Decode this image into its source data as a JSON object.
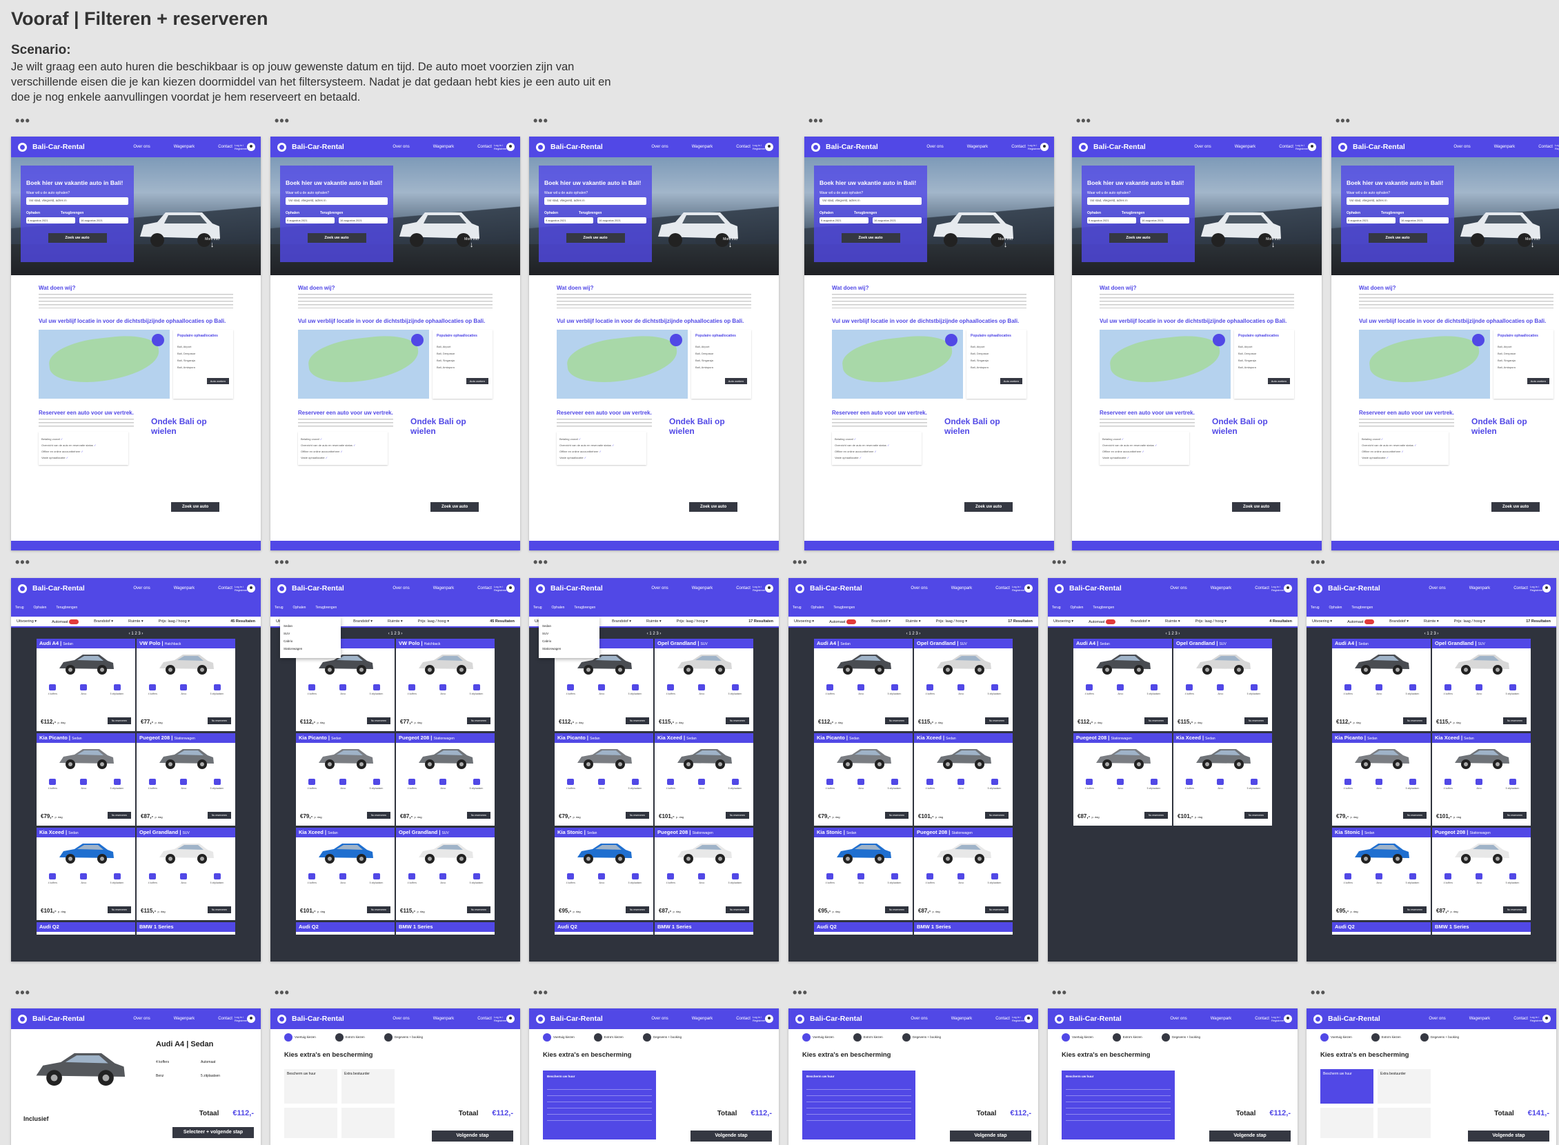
{
  "title": "Vooraf | Filteren + reserveren",
  "scenario_heading": "Scenario:",
  "scenario_text": "Je wilt graag een auto huren die beschikbaar is op jouw gewenste datum en tijd. De auto moet voorzien zijn van verschillende eisen die je kan kiezen doormiddel van het filtersysteem. Nadat je dat gedaan hebt kies je een auto uit en doe je nog enkele aanvullingen voordat je hem reserveert en betaald.",
  "brand": "Bali-Car-Rental",
  "nav": [
    "Over ons",
    "Wagenpark",
    "Contact"
  ],
  "login": "Log in / Registreer",
  "hero": {
    "title": "Boek hier uw vakantie auto in Bali!",
    "where": "Waar wil u de auto ophalen?",
    "where_placeholder": "Vul stad, vliegveld, adres in",
    "ophalen": "Ophalen",
    "terugbrengen": "Terugbrengen",
    "date1": "9 augustus 2021",
    "date2": "16 augustus 2021",
    "button": "Zoek uw auto",
    "more": "More info"
  },
  "home": {
    "wat": "Wat doen wij?",
    "vul": "Vul uw verblijf locatie in voor de dichtstbijzijnde ophaallocaties op Bali.",
    "pop": "Populaire ophaallocaties",
    "locs": [
      "Bali, Airport",
      "Bali, Denpasar",
      "Bali, Singaraja",
      "Bali, Amlapura"
    ],
    "auto_zoeken": "Auto zoeken",
    "res": "Reserveer een auto voor uw vertrek.",
    "ondek": "Ondek Bali op wielen",
    "checks": [
      "Betaling vooraf",
      "Overzicht van de auto en reservatie status",
      "Offline en online accountbeheer",
      "Vaste ophaallocatie"
    ],
    "zoek": "Zoek uw auto"
  },
  "results": {
    "back": "Terug",
    "ophalen": "Ophalen",
    "terug": "Terugbrengen",
    "filters": [
      "Uitvoering",
      "Automaat",
      "Brandstof",
      "Ruimte",
      "Prijs: laag / hoog"
    ],
    "counts": [
      "45 Resultaten",
      "45 Resultaten",
      "17 Resultaten",
      "17 Resultaten",
      "4 Resultaten",
      "17 Resultaten"
    ],
    "pages": "‹ 1 2 3 ›",
    "dropdown": [
      "Sedan",
      "SUV",
      "Cabrio",
      "Stationwagen"
    ],
    "reserveren": "Nu reserveren",
    "per": "p. dag"
  },
  "screens": [
    [
      {
        "n": "Audi A4",
        "t": "Sedan",
        "p": "€112,-"
      },
      {
        "n": "VW Polo",
        "t": "Hatchback",
        "p": "€77,-"
      },
      {
        "n": "Kia Picanto",
        "t": "Sedan",
        "p": "€79,-"
      },
      {
        "n": "Puegeot 208",
        "t": "Stationwagen",
        "p": "€87,-"
      },
      {
        "n": "Kia Xceed",
        "t": "Sedan",
        "p": "€101,-"
      },
      {
        "n": "Opel Grandland",
        "t": "SUV",
        "p": "€115,-"
      }
    ],
    [
      {
        "n": "Audi A4",
        "t": "Sedan",
        "p": "€112,-"
      },
      {
        "n": "VW Polo",
        "t": "Hatchback",
        "p": "€77,-"
      },
      {
        "n": "Kia Picanto",
        "t": "Sedan",
        "p": "€79,-"
      },
      {
        "n": "Puegeot 208",
        "t": "Stationwagen",
        "p": "€87,-"
      },
      {
        "n": "Kia Xceed",
        "t": "Sedan",
        "p": "€101,-"
      },
      {
        "n": "Opel Grandland",
        "t": "SUV",
        "p": "€115,-"
      }
    ],
    [
      {
        "n": "Audi A4",
        "t": "Sedan",
        "p": "€112,-"
      },
      {
        "n": "Opel Grandland",
        "t": "SUV",
        "p": "€115,-"
      },
      {
        "n": "Kia Picanto",
        "t": "Sedan",
        "p": "€79,-"
      },
      {
        "n": "Kia Xceed",
        "t": "Sedan",
        "p": "€101,-"
      },
      {
        "n": "Kia Stonic",
        "t": "Sedan",
        "p": "€95,-"
      },
      {
        "n": "Puegeot 208",
        "t": "Stationwagen",
        "p": "€87,-"
      }
    ],
    [
      {
        "n": "Audi A4",
        "t": "Sedan",
        "p": "€112,-"
      },
      {
        "n": "Opel Grandland",
        "t": "SUV",
        "p": "€115,-"
      },
      {
        "n": "Kia Picanto",
        "t": "Sedan",
        "p": "€79,-"
      },
      {
        "n": "Kia Xceed",
        "t": "Sedan",
        "p": "€101,-"
      },
      {
        "n": "Kia Stonic",
        "t": "Sedan",
        "p": "€95,-"
      },
      {
        "n": "Puegeot 208",
        "t": "Stationwagen",
        "p": "€87,-"
      }
    ],
    [
      {
        "n": "Audi A4",
        "t": "Sedan",
        "p": "€112,-"
      },
      {
        "n": "Opel Grandland",
        "t": "SUV",
        "p": "€115,-"
      },
      {
        "n": "Puegeot 208",
        "t": "Stationwagen",
        "p": "€87,-"
      },
      {
        "n": "Kia Xceed",
        "t": "Sedan",
        "p": "€101,-"
      }
    ],
    [
      {
        "n": "Audi A4",
        "t": "Sedan",
        "p": "€112,-"
      },
      {
        "n": "Opel Grandland",
        "t": "SUV",
        "p": "€115,-"
      },
      {
        "n": "Kia Picanto",
        "t": "Sedan",
        "p": "€79,-"
      },
      {
        "n": "Kia Xceed",
        "t": "Sedan",
        "p": "€101,-"
      },
      {
        "n": "Kia Stonic",
        "t": "Sedan",
        "p": "€95,-"
      },
      {
        "n": "Puegeot 208",
        "t": "Stationwagen",
        "p": "€87,-"
      }
    ]
  ],
  "next_row": [
    [
      "Audi Q2",
      "BMW 1 Series"
    ],
    [
      "Audi Q2",
      "BMW 1 Series"
    ],
    [
      "Audi Q2",
      "BMW 1 Series"
    ],
    [
      "Audi Q2",
      "BMW 1 Series"
    ],
    [
      "",
      ""
    ],
    [
      "Audi Q2",
      "BMW 1 Series"
    ]
  ],
  "detail": {
    "name": "Audi A4 | Sedan",
    "inclusief": "Inclusief",
    "totaal": "Totaal",
    "price": "€112,-",
    "per": "p. dag",
    "select": "Selecteer + volgende stap",
    "specs": [
      "4 koffers",
      "Automaat",
      "Benz",
      "5 zitplaatsen"
    ]
  },
  "steps": [
    "Voertuig kiezen",
    "Extra's kiezen",
    "Gegevens + booking"
  ],
  "extras": {
    "title": "Kies extra's en bescherming",
    "bescherm": "Bescherm uw huur",
    "extra": "Extra bestuurder",
    "next": "Volgende stap",
    "totals": [
      "€112,-",
      "€112,-",
      "€112,-",
      "€112,-",
      "€141,-"
    ]
  }
}
